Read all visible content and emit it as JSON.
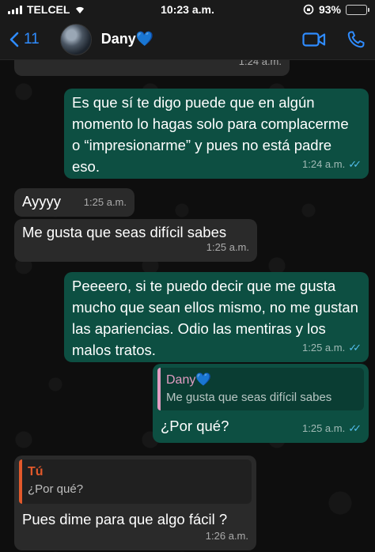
{
  "status_bar": {
    "carrier": "TELCEL",
    "time": "10:23 a.m.",
    "battery": "93%",
    "battery_level": 0.93
  },
  "header": {
    "back_count": "11",
    "contact_name": "Dany",
    "contact_heart": "💙",
    "back_icon": "chevron-left-icon",
    "video_icon": "video-camera-icon",
    "call_icon": "phone-icon"
  },
  "colors": {
    "incoming": "#2a2a2a",
    "outgoing": "#0d4f42",
    "accent": "#2f8cff",
    "read_ticks": "#53bdeb"
  },
  "messages": [
    {
      "dir": "in",
      "text": "",
      "time": "1:24 a.m."
    },
    {
      "dir": "out",
      "text": "Es que sí te digo puede que en algún momento lo hagas solo para complacerme o “impresionarme” y pues no está padre eso.",
      "time": "1:24 a.m.",
      "read": true
    },
    {
      "dir": "in",
      "text": "Ayyyy",
      "time": "1:25 a.m."
    },
    {
      "dir": "in",
      "text": "Me gusta que seas difícil sabes",
      "time": "1:25 a.m."
    },
    {
      "dir": "out",
      "text": "Peeeero, si te puedo decir que me gusta mucho que sean ellos mismo, no me gustan las apariencias. Odio las mentiras y los malos tratos.",
      "time": "1:25 a.m.",
      "read": true
    },
    {
      "dir": "out",
      "quote_name": "Dany💙",
      "quote_text": "Me gusta que seas difícil sabes",
      "text": "¿Por qué?",
      "time": "1:25 a.m.",
      "read": true
    },
    {
      "dir": "in",
      "quote_name": "Tú",
      "quote_text": "¿Por qué?",
      "text": "Pues dime para que algo fácil ?",
      "time": "1:26 a.m."
    }
  ]
}
